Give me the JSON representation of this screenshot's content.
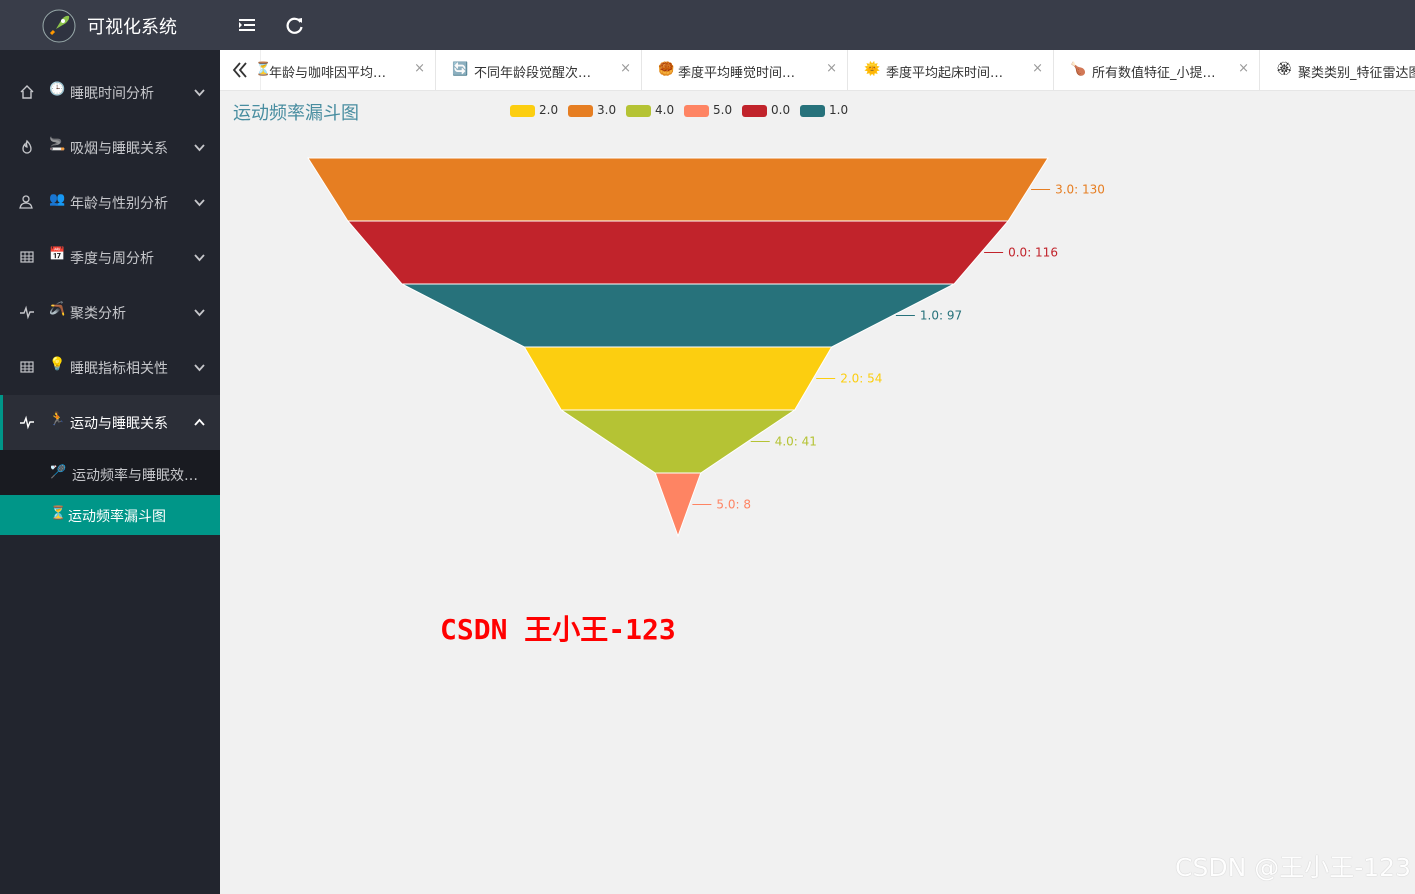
{
  "header": {
    "app_title": "可视化系统",
    "logo_icon": "rocket-icon",
    "colors": {
      "bar": "#393d49",
      "sidebar": "#22252e",
      "accent": "#009688"
    }
  },
  "sidebar": {
    "items": [
      {
        "lead_icon": "home-icon",
        "emoji": "🕒",
        "label": "睡眠时间分析",
        "expanded": false
      },
      {
        "lead_icon": "fire-icon",
        "emoji": "🚬",
        "label": "吸烟与睡眠关系",
        "expanded": false
      },
      {
        "lead_icon": "user-icon",
        "emoji": "👥",
        "label": "年龄与性别分析",
        "expanded": false
      },
      {
        "lead_icon": "grid-icon",
        "emoji": "📅",
        "label": "季度与周分析",
        "expanded": false
      },
      {
        "lead_icon": "pulse-icon",
        "emoji": "🪃",
        "label": "聚类分析",
        "expanded": false
      },
      {
        "lead_icon": "grid-icon",
        "emoji": "💡",
        "label": "睡眠指标相关性",
        "expanded": false
      },
      {
        "lead_icon": "pulse-icon",
        "emoji": "🏃",
        "label": "运动与睡眠关系",
        "expanded": true
      }
    ],
    "sub_items": [
      {
        "emoji": "🏸",
        "label": "运动频率与睡眠效率分析",
        "active": false
      },
      {
        "emoji": "⏳",
        "label": "运动频率漏斗图",
        "active": true
      }
    ]
  },
  "tabs": [
    {
      "icon": "⏳",
      "label": "年龄与咖啡因平均摄入量",
      "close": "×"
    },
    {
      "icon": "🔄",
      "label": "不同年龄段觉醒次数分析",
      "close": "×"
    },
    {
      "icon": "🥮",
      "label": "季度平均睡觉时间柱状图",
      "close": "×"
    },
    {
      "icon": "🌞",
      "label": "季度平均起床时间折线图",
      "close": "×"
    },
    {
      "icon": "🍗",
      "label": "所有数值特征_小提琴图",
      "close": "×"
    },
    {
      "icon": "🏵",
      "label": "聚类类别_特征雷达图",
      "close": "×"
    }
  ],
  "chart_data": {
    "type": "funnel",
    "title": "运动频率漏斗图",
    "legend": [
      "2.0",
      "3.0",
      "4.0",
      "5.0",
      "0.0",
      "1.0"
    ],
    "legend_position": "top",
    "sort": "descending",
    "items": [
      {
        "name": "3.0",
        "value": 130,
        "color": "#e67e22",
        "label": "3.0: 130"
      },
      {
        "name": "0.0",
        "value": 116,
        "color": "#c1232b",
        "label": "0.0: 116"
      },
      {
        "name": "1.0",
        "value": 97,
        "color": "#27727b",
        "label": "1.0: 97"
      },
      {
        "name": "2.0",
        "value": 54,
        "color": "#fcce10",
        "label": "2.0: 54"
      },
      {
        "name": "4.0",
        "value": 41,
        "color": "#b5c334",
        "label": "4.0: 41"
      },
      {
        "name": "5.0",
        "value": 8,
        "color": "#fe8463",
        "label": "5.0: 8"
      }
    ],
    "max": 130
  },
  "watermarks": {
    "red": "CSDN 王小王-123",
    "grey": "CSDN @王小王-123"
  }
}
